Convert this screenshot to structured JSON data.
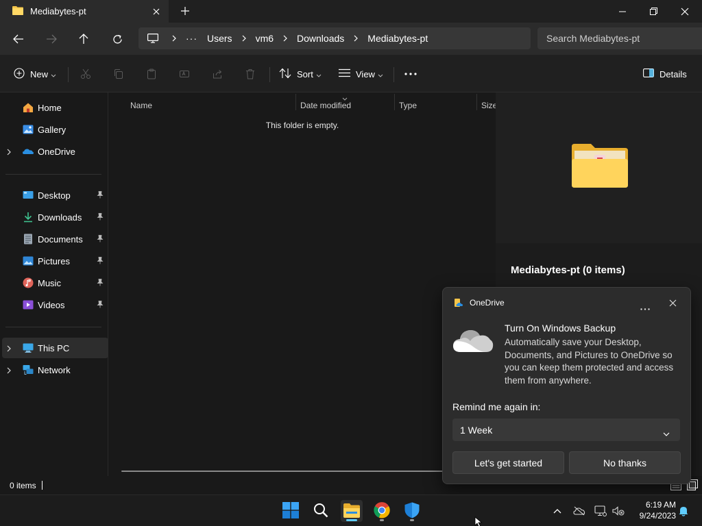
{
  "window": {
    "tab_title": "Mediabytes-pt"
  },
  "address": {
    "breadcrumbs": [
      "Users",
      "vm6",
      "Downloads",
      "Mediabytes-pt"
    ],
    "search_placeholder": "Search Mediabytes-pt"
  },
  "commandbar": {
    "new_label": "New",
    "sort_label": "Sort",
    "view_label": "View",
    "details_label": "Details"
  },
  "sidebar": {
    "top_items": [
      {
        "label": "Home",
        "icon": "home-icon"
      },
      {
        "label": "Gallery",
        "icon": "gallery-icon"
      },
      {
        "label": "OneDrive",
        "icon": "onedrive-icon"
      }
    ],
    "pinned_items": [
      {
        "label": "Desktop",
        "icon": "desktop-folder-icon"
      },
      {
        "label": "Downloads",
        "icon": "downloads-folder-icon"
      },
      {
        "label": "Documents",
        "icon": "documents-folder-icon"
      },
      {
        "label": "Pictures",
        "icon": "pictures-folder-icon"
      },
      {
        "label": "Music",
        "icon": "music-folder-icon"
      },
      {
        "label": "Videos",
        "icon": "videos-folder-icon"
      }
    ],
    "bottom_items": [
      {
        "label": "This PC",
        "icon": "this-pc-icon"
      },
      {
        "label": "Network",
        "icon": "network-icon"
      }
    ]
  },
  "filelist": {
    "columns": [
      "Name",
      "Date modified",
      "Type",
      "Size"
    ],
    "empty_message": "This folder is empty."
  },
  "details": {
    "title": "Mediabytes-pt (0 items)"
  },
  "status": {
    "item_count": "0 items"
  },
  "onedrive_popup": {
    "app_name": "OneDrive",
    "heading": "Turn On Windows Backup",
    "body": "Automatically save your Desktop, Documents, and Pictures to OneDrive so you can keep them protected and access them from anywhere.",
    "remind_label": "Remind me again in:",
    "remind_value": "1 Week",
    "primary_button": "Let's get started",
    "secondary_button": "No thanks"
  },
  "taskbar": {
    "time": "6:19 AM",
    "date": "9/24/2023"
  },
  "colors": {
    "accent": "#60cdff",
    "folder_yellow": "#f4c54a"
  }
}
